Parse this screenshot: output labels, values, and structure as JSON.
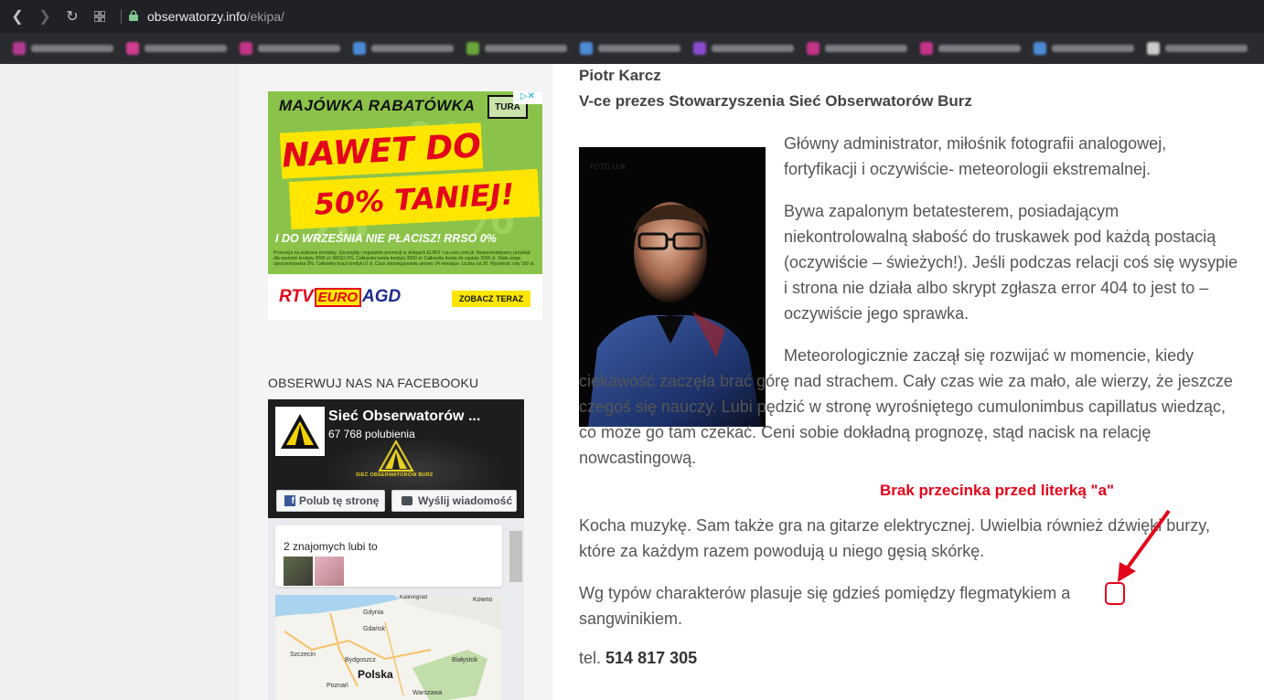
{
  "browser": {
    "url_domain": "obserwatorzy.info",
    "url_path": "/ekipa/",
    "bookmark_colors": [
      "#b23a8f",
      "#d13d8f",
      "#c4338a",
      "#4c8bd6",
      "#6aa63a",
      "#4c8bd6",
      "#8a4bd1",
      "#c4338a",
      "#c4338a",
      "#4c8bd6",
      "#cccccc"
    ]
  },
  "ad": {
    "title": "MAJÓWKA RABATÓWKA",
    "brand_logo": "TURA",
    "line1": "NAWET DO",
    "line2": "50% TANIEJ!",
    "subline": "I DO WRZEŚNIA NIE PŁACISZ!  RRSO 0%",
    "fine_print": "Promocja na wybrane produkty. Szczegóły i regulamin promocji w sklepach EURO i na euro.com.pl. Reprezentatywny przykład dla wartości kredytu 3000 zł: RRSO 0%. Całkowita kwota kredytu 3000 zł. Całkowita kwota do zapłaty 3000 zł. Stała stopa oprocentowania 0%. Całkowity koszt kredytu 0 zł. Czas obowiązywania umowy 24 miesiące. Liczba rat 20. Wysokość raty 150 zł.",
    "store_rtv": "RTV",
    "store_euro": "EURO",
    "store_agd": "AGD",
    "cta": "ZOBACZ TERAZ",
    "adchoice": "▷✕"
  },
  "sidebar": {
    "fb_heading": "OBSERWUJ NAS NA FACEBOOKU",
    "fb_page_name": "Sieć Obserwatorów ...",
    "fb_likes": "67 768 polubienia",
    "fb_emblem_text": "SIEĆ OBSERWATORÓW BURZ",
    "fb_like_button": "Polub tę stronę",
    "fb_message_button": "Wyślij wiadomość",
    "fb_friends_text": "2 znajomych lubi to",
    "map_labels": [
      "Gdynia",
      "Gdańsk",
      "Szczecin",
      "Bydgoszcz",
      "Białystok",
      "Polska",
      "Poznań",
      "Warszawa",
      "Kowno",
      "Kaliningrad"
    ]
  },
  "content": {
    "name": "Piotr Karcz",
    "role": "V-ce prezes Stowarzyszenia Sieć Obserwatorów Burz",
    "p1": "Główny administrator, miłośnik fotografii analogowej, fortyfikacji i oczywiście- meteorologii ekstremalnej.",
    "p2": "Bywa  zapalonym betatesterem, posiadającym niekontrolowalną słabość do truskawek pod każdą postacią (oczywiście – świeżych!). Jeśli podczas relacji coś się wysypie i strona nie działa albo skrypt zgłasza error 404 to jest to – oczywiście jego sprawka.",
    "p3": "Meteorologicznie zaczął się rozwijać w momencie, kiedy ciekawość zaczęła brać górę nad strachem. Cały czas wie za mało, ale wierzy, że jeszcze czegoś się nauczy. Lubi pędzić w stronę wyrośniętego cumulonimbus capillatus wiedząc, co może go tam czekać. Ceni sobie dokładną prognozę, stąd nacisk na relację nowcastingową.",
    "p4": "Kocha muzykę. Sam także gra na gitarze elektrycznej. Uwielbia również dźwięki burzy, które za każdym razem powodują u niego gęsią skórkę.",
    "p5": "Wg typów charakterów plasuje się gdzieś pomiędzy flegmatykiem a sangwinikiem.",
    "tel_label": "tel.",
    "tel_number": "514 817 305",
    "photo_watermark": "FOTO LUK"
  },
  "annotation": {
    "text": "Brak przecinka przed literką \"a\"",
    "color": "#e3051b"
  }
}
